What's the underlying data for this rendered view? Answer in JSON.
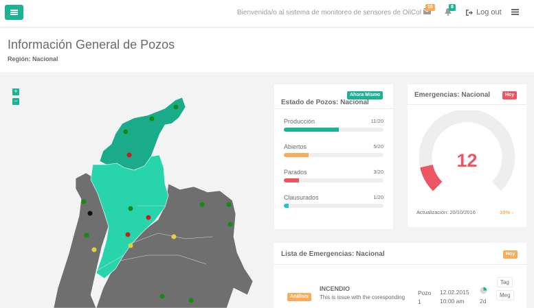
{
  "topbar": {
    "welcome": "Bienvenida/o al sistema de monitoreo de sensores de OilCol",
    "messages_count": "16",
    "alerts_count": "8",
    "logout_label": "Log out",
    "icons": [
      "bars-icon",
      "envelope-icon",
      "bell-icon",
      "sign-out-icon",
      "tasks-icon"
    ]
  },
  "header": {
    "title": "Información General de Pozos",
    "region": "Región: Nacional"
  },
  "map": {
    "zoom_in": "+",
    "zoom_out": "−"
  },
  "estado": {
    "title": "Estado de Pozos: Nacional",
    "badge": "Ahora Mismo",
    "items": [
      {
        "label": "Producción",
        "value": "11/20",
        "fraction": 0.55,
        "color": "#1ab394"
      },
      {
        "label": "Abiertos",
        "value": "5/20",
        "fraction": 0.25,
        "color": "#f8ac59"
      },
      {
        "label": "Parados",
        "value": "3/20",
        "fraction": 0.15,
        "color": "#ed5565"
      },
      {
        "label": "Clausurados",
        "value": "1/20",
        "fraction": 0.05,
        "color": "#23c6c8"
      }
    ]
  },
  "emergencias": {
    "title": "Emergencias: Nacional",
    "badge": "Hoy",
    "count": "12",
    "gauge_fraction": 0.12,
    "update_label": "Actualización: 20/10/2016",
    "change": "10% ↓"
  },
  "lista": {
    "title": "Lista de Emergencias: Nacional",
    "badge": "Hoy",
    "row": {
      "status": "Análisis",
      "type": "INCENDIO",
      "description": "This is issue with the coresponding",
      "pozo": "Pozo 1",
      "date": "12.02.2015",
      "time": "10:00 am",
      "age": "2d",
      "tag_btn": "Tag",
      "meg_btn": "Meg"
    }
  },
  "colors": {
    "accent": "#1ab394",
    "warning": "#f8ac59",
    "danger": "#ed5565",
    "info": "#23c6c8",
    "map_gray": "#6f6f6f",
    "map_teal_dark": "#1aab8b",
    "map_teal_light": "#28d4ac"
  }
}
